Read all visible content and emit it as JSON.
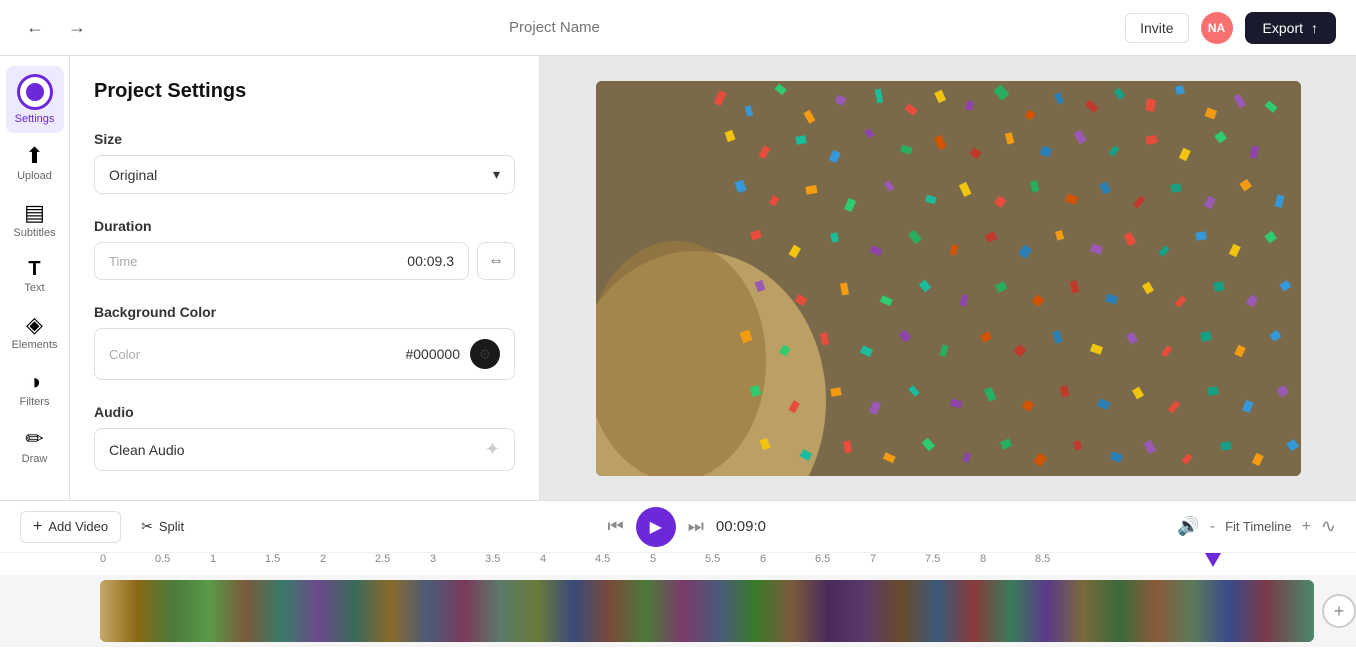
{
  "topbar": {
    "project_name_placeholder": "Project Name",
    "invite_label": "Invite",
    "avatar_initials": "NA",
    "export_label": "Export",
    "undo_icon": "←",
    "redo_icon": "→",
    "upload_icon": "↑"
  },
  "sidebar": {
    "items": [
      {
        "id": "settings",
        "label": "Settings",
        "icon": "⚙",
        "active": true
      },
      {
        "id": "upload",
        "label": "Upload",
        "icon": "↑",
        "active": false
      },
      {
        "id": "subtitles",
        "label": "Subtitles",
        "icon": "≡",
        "active": false
      },
      {
        "id": "text",
        "label": "Text",
        "icon": "T",
        "active": false
      },
      {
        "id": "elements",
        "label": "Elements",
        "icon": "◈",
        "active": false
      },
      {
        "id": "filters",
        "label": "Filters",
        "icon": "◑",
        "active": false
      },
      {
        "id": "draw",
        "label": "Draw",
        "icon": "✏",
        "active": false
      }
    ]
  },
  "settings_panel": {
    "title": "Project Settings",
    "size_section": {
      "label": "Size",
      "value": "Original",
      "chevron": "▾"
    },
    "duration_section": {
      "label": "Duration",
      "field_label": "Time",
      "value": "00:09.3",
      "swap_icon": "⇔"
    },
    "background_color_section": {
      "label": "Background Color",
      "field_label": "Color",
      "hex_value": "#000000",
      "picker_icon": "🎨"
    },
    "audio_section": {
      "label": "Audio",
      "field_value": "Clean Audio",
      "star_icon": "✦"
    }
  },
  "playback": {
    "add_video_label": "Add Video",
    "split_label": "Split",
    "skip_back_icon": "⏮",
    "play_icon": "▶",
    "skip_forward_icon": "⏭",
    "time_display": "00:09:0",
    "volume_icon": "🔊",
    "minus_label": "-",
    "fit_timeline_label": "Fit Timeline",
    "plus_label": "+",
    "waveform_icon": "∿"
  },
  "ruler": {
    "marks": [
      "0",
      "0.5",
      "1",
      "1.5",
      "2",
      "2.5",
      "3",
      "3.5",
      "4",
      "4.5",
      "5",
      "5.5",
      "6",
      "6.5",
      "7",
      "7.5",
      "8",
      "8.5"
    ],
    "playhead_position": "88.5"
  },
  "colors": {
    "accent": "#6d28d9",
    "bg_dark": "#1a1a2e",
    "avatar_bg": "#f87171"
  }
}
